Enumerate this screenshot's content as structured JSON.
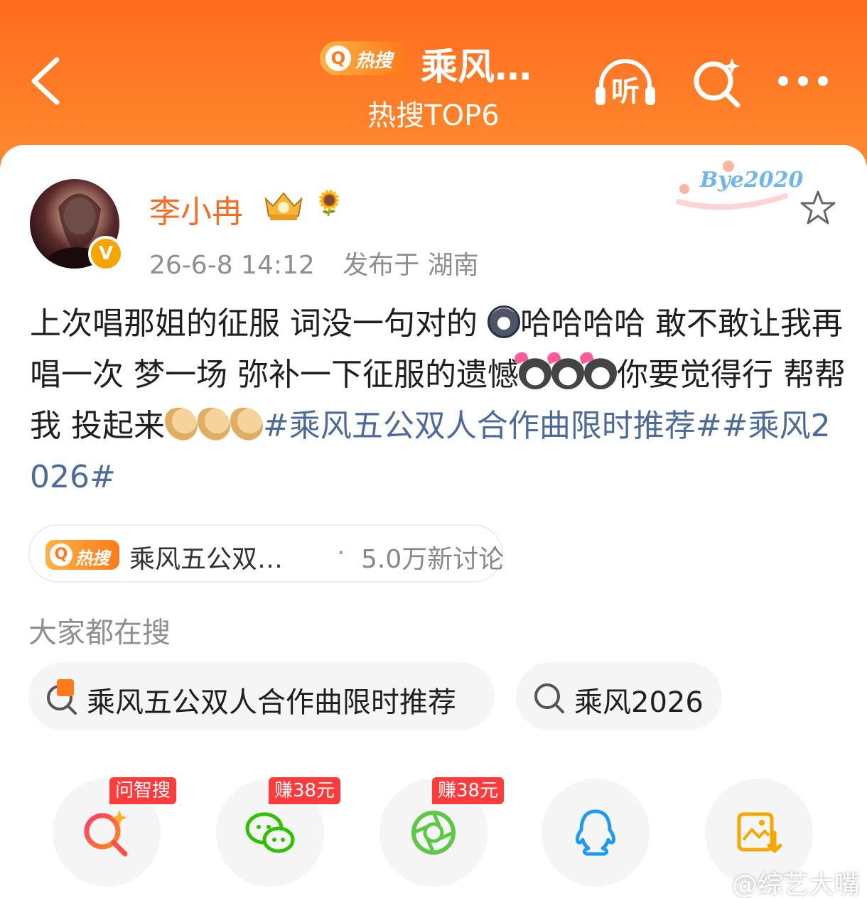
{
  "header": {
    "hot_logo_text": "热搜",
    "title": "乘风…",
    "subtitle": "热搜TOP6",
    "listen_label": "听"
  },
  "post": {
    "username": "李小冉",
    "decoration_text": "Bye2020",
    "time": "26-6-8 14:12",
    "location": "发布于 湖南",
    "text_part1": "上次唱那姐的征服 词没一句对的 ",
    "text_part2": "哈哈哈哈 敢不敢让我再唱一次 梦一场 弥补一下征服的遗憾",
    "text_part3": "你要觉得行 帮帮我 投起来",
    "tag1": "#乘风五公双人合作曲限时推荐#",
    "tag2": "#乘风2026#"
  },
  "hot_pill": {
    "logo_text": "热搜",
    "topic": "乘风五公双…",
    "separator": "·",
    "count": "5.0万新讨论"
  },
  "search_section": {
    "label": "大家都在搜",
    "chips": [
      "乘风五公双人合作曲限时推荐",
      "乘风2026"
    ]
  },
  "share": {
    "badges": [
      "问智搜",
      "赚38元",
      "赚38元"
    ]
  },
  "watermark": "@综艺大嘴",
  "colors": {
    "brand_orange": "#ff6b1f",
    "username": "#f56e26",
    "topic_link": "#4d6b9a",
    "badge_red": "#ff3b3b"
  }
}
